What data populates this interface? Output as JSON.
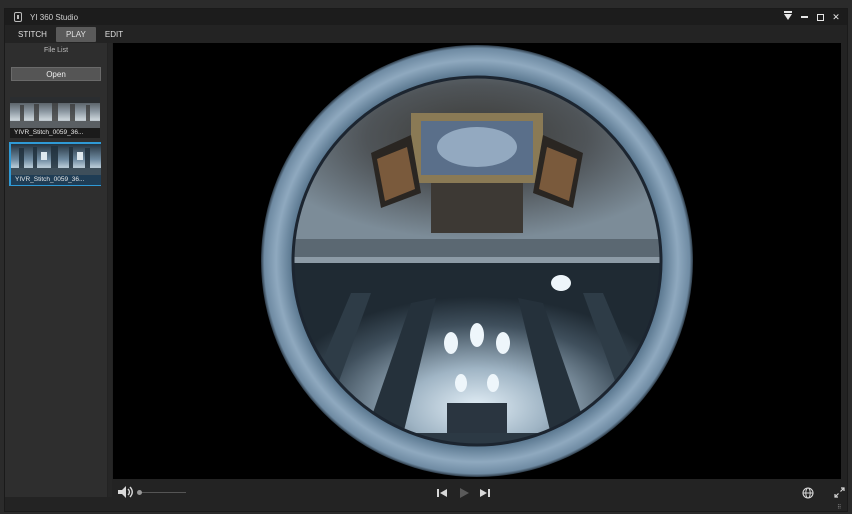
{
  "window": {
    "title": "YI 360 Studio",
    "icons": [
      "app-icon",
      "menu-dropdown-icon",
      "minimize-icon",
      "maximize-icon",
      "close-icon"
    ]
  },
  "tabs": [
    {
      "label": "STITCH",
      "active": false
    },
    {
      "label": "PLAY",
      "active": true
    },
    {
      "label": "EDIT",
      "active": false
    }
  ],
  "sidebar": {
    "header": "File List",
    "open_label": "Open",
    "files": [
      {
        "name": "YIVR_Stitch_0059_36...",
        "selected": false
      },
      {
        "name": "YIVR_Stitch_0059_36...",
        "selected": true
      }
    ]
  },
  "player": {
    "controls": [
      "volume-icon",
      "previous-icon",
      "play-icon",
      "next-icon",
      "globe-icon",
      "fullscreen-icon"
    ]
  },
  "colors": {
    "accent": "#2f9ad6",
    "background": "#232323",
    "viewer": "#000000"
  }
}
